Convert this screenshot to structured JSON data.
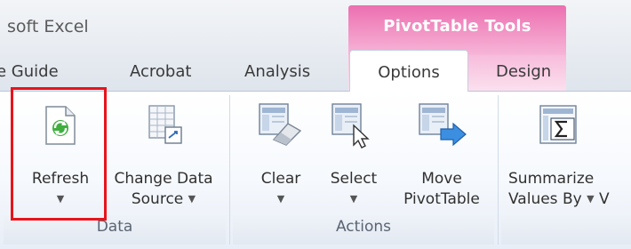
{
  "window": {
    "app_title": "soft Excel"
  },
  "context_group": {
    "label": "PivotTable Tools"
  },
  "tabs": [
    {
      "label": "e Guide"
    },
    {
      "label": "Acrobat"
    },
    {
      "label": "Analysis"
    },
    {
      "label": "Options",
      "active": true
    },
    {
      "label": "Design"
    }
  ],
  "groups": {
    "data": {
      "label": "Data",
      "refresh": {
        "label": "Refresh",
        "dropdown": "▼"
      },
      "change_source": {
        "line1": "Change Data",
        "line2": "Source",
        "dropdown": "▼"
      }
    },
    "actions": {
      "label": "Actions",
      "clear": {
        "label": "Clear",
        "dropdown": "▼"
      },
      "select": {
        "label": "Select",
        "dropdown": "▼"
      },
      "move": {
        "line1": "Move",
        "line2": "PivotTable"
      }
    },
    "calculations": {
      "summarize": {
        "line1": "Summarize",
        "line2": "Values By",
        "dropdown": "▼",
        "cut_text": "V"
      }
    }
  },
  "highlight_color": "#e8141c",
  "context_color": "#ec6fb0"
}
